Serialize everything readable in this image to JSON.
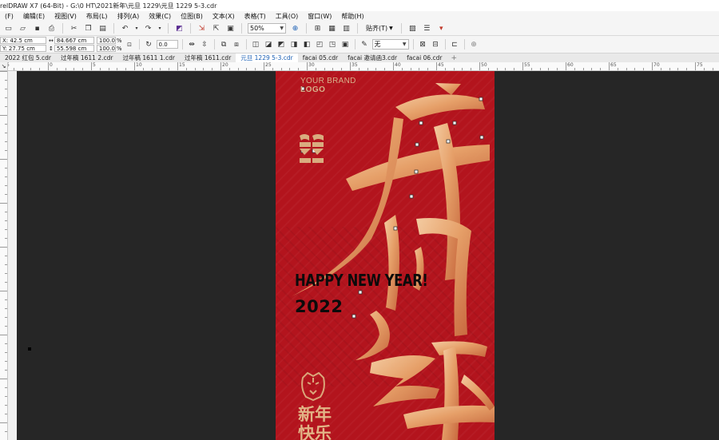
{
  "title": "relDRAW X7 (64-Bit) - G:\\0 HT\\2021新年\\元旦 1229\\元旦 1229 5-3.cdr",
  "menu": [
    "(F)",
    "编辑(E)",
    "视图(V)",
    "布局(L)",
    "排列(A)",
    "效果(C)",
    "位图(B)",
    "文本(X)",
    "表格(T)",
    "工具(O)",
    "窗口(W)",
    "帮助(H)"
  ],
  "toolbar": {
    "zoom": "50%",
    "snap_label": "贴齐(T)"
  },
  "properties": {
    "x": "X: 42.5 cm",
    "y": "Y: 27.75 cm",
    "width": "84.667 cm",
    "height": "55.598 cm",
    "scale_w": "100.0",
    "scale_h": "100.0",
    "percent": "%",
    "rotation": "0.0",
    "outline": "无"
  },
  "tabs": [
    {
      "label": "2022 红包 5.cdr",
      "active": false
    },
    {
      "label": "过年稿 1611 2.cdr",
      "active": false
    },
    {
      "label": "过年稿 1611 1.cdr",
      "active": false
    },
    {
      "label": "过年稿 1611.cdr",
      "active": false
    },
    {
      "label": "元旦 1229 5-3.cdr",
      "active": true
    },
    {
      "label": "facai 05.cdr",
      "active": false
    },
    {
      "label": "facai 邀请函3.cdr",
      "active": false
    },
    {
      "label": "facai 06.cdr",
      "active": false
    }
  ],
  "ruler": {
    "h_labels": [
      "5",
      "0",
      "5",
      "10",
      "15",
      "20",
      "25",
      "30",
      "35",
      "40",
      "45",
      "50",
      "55",
      "60",
      "65",
      "70",
      "75",
      "80"
    ]
  },
  "poster": {
    "brand_line1": "YOUR BRAND",
    "brand_line2": "LOGO",
    "headline": "HAPPY NEW YEAR!",
    "year": "2022",
    "newyear_cn": "新年快乐",
    "bg_color": "#b3141d",
    "gold": "#e4a86e"
  }
}
